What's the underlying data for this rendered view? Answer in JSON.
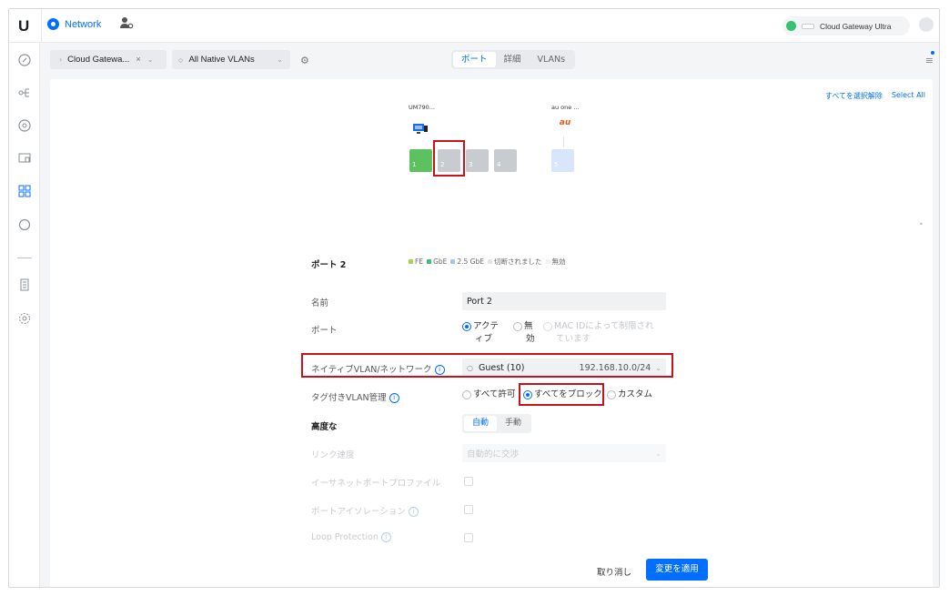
{
  "app": {
    "logo": "U",
    "tab_label": "Network"
  },
  "gateway": {
    "name": "Cloud Gateway Ultra"
  },
  "toolbar": {
    "device_filter": "Cloud Gatewa...",
    "vlan_filter": "All Native VLANs",
    "tabs": [
      {
        "label": "ポート"
      },
      {
        "label": "詳細"
      },
      {
        "label": "VLANs"
      }
    ],
    "active_tab": "ポート"
  },
  "selection": {
    "deselect_all": "すべてを選択解除",
    "select_all": "Select All"
  },
  "devices": [
    {
      "name": "UM790..."
    },
    {
      "name": "au one ...",
      "logo_text": "au"
    }
  ],
  "ports": [
    {
      "number": "1",
      "state": "FE-connected",
      "color": "#5cc15f"
    },
    {
      "number": "2",
      "state": "selected",
      "color": "#c8cbcf"
    },
    {
      "number": "3",
      "state": "disconnected",
      "color": "#c8cbcf"
    },
    {
      "number": "4",
      "state": "disconnected",
      "color": "#c8cbcf"
    },
    {
      "number": "5",
      "state": "2.5GbE",
      "color": "#d7e6fb"
    }
  ],
  "legend": [
    {
      "label": "FE",
      "color": "#a8d34a"
    },
    {
      "label": "GbE",
      "color": "#38c172"
    },
    {
      "label": "2.5 GbE",
      "color": "#9fc3f5"
    },
    {
      "label": "切断されました",
      "color": "#e2e4e7"
    },
    {
      "label": "無効",
      "color": "#f0f1f2"
    }
  ],
  "form": {
    "section_title": "ポート 2",
    "name_label": "名前",
    "name_value": "Port 2",
    "port_label": "ポート",
    "port_options": [
      {
        "label_line1": "アクテ",
        "label_line2": "ィブ",
        "selected": true
      },
      {
        "label_line1": "無",
        "label_line2": "効",
        "selected": false
      },
      {
        "label_line1": "MAC IDによって制限され",
        "label_line2": "ています",
        "selected": false,
        "disabled": true
      }
    ],
    "native_vlan_label": "ネイティブVLAN/ネットワーク",
    "native_vlan_value": "Guest (10)",
    "native_vlan_subnet": "192.168.10.0/24",
    "tagged_label": "タグ付きVLAN管理",
    "tagged_options": [
      {
        "label": "すべて許可",
        "selected": false
      },
      {
        "label": "すべてをブロック",
        "selected": true
      },
      {
        "label": "カスタム",
        "selected": false
      }
    ],
    "advanced_label": "高度な",
    "advanced_options": [
      {
        "label": "自動"
      },
      {
        "label": "手動"
      }
    ],
    "advanced_selected": "自動",
    "link_speed_label": "リンク速度",
    "link_speed_value": "自動的に交渉",
    "ethernet_profile_label": "イーサネットポートプロファイル",
    "isolation_label": "ポートアイソレーション",
    "loop_label": "Loop Protection",
    "cancel_label": "取り消し",
    "apply_label": "変更を適用"
  }
}
